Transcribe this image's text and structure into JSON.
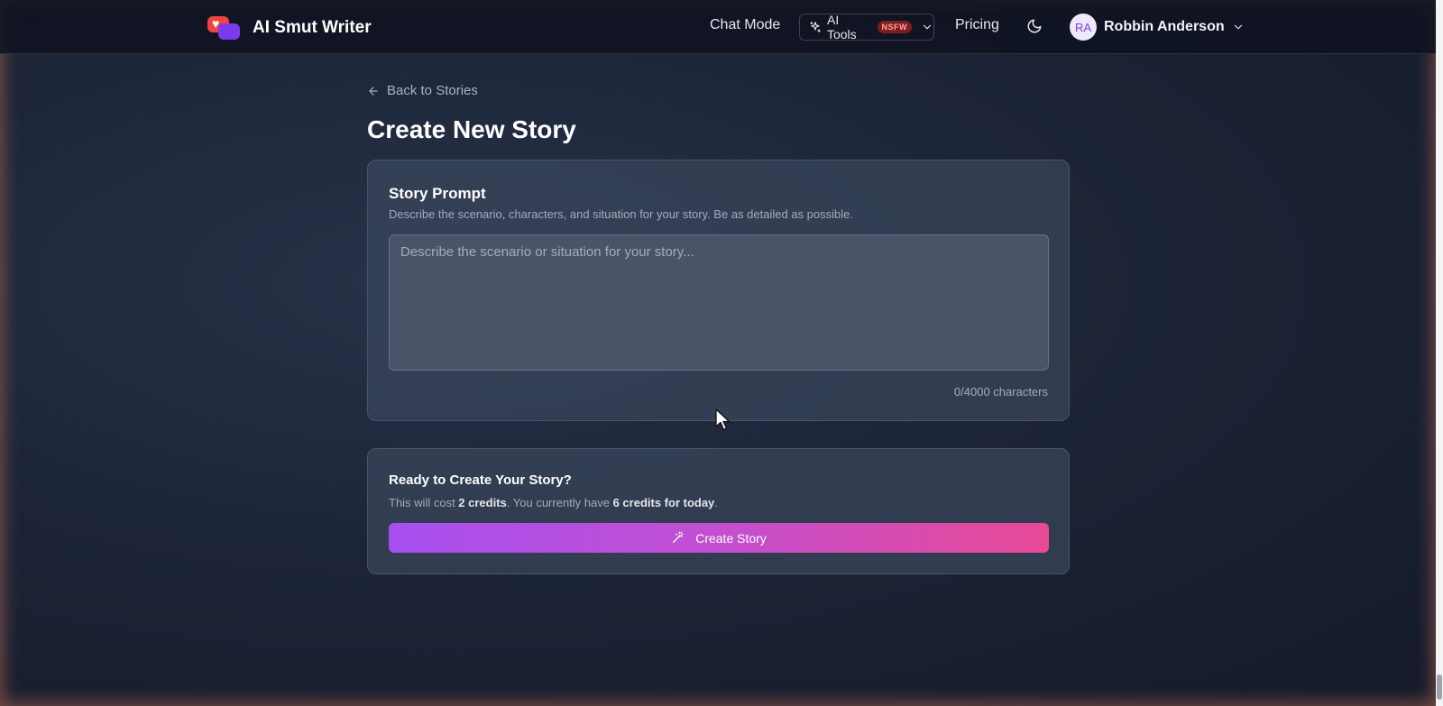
{
  "header": {
    "brand_name": "AI Smut Writer",
    "nav_chat_mode": "Chat Mode",
    "ai_tools_label": "AI Tools",
    "ai_tools_badge": "NSFW",
    "nav_pricing": "Pricing",
    "user_initials": "RA",
    "user_name": "Robbin Anderson"
  },
  "main": {
    "back_link": "Back to Stories",
    "page_title": "Create New Story"
  },
  "prompt_card": {
    "title": "Story Prompt",
    "description": "Describe the scenario, characters, and situation for your story. Be as detailed as possible.",
    "input_value": "",
    "input_placeholder": "Describe the scenario or situation for your story...",
    "char_count": "0/4000 characters"
  },
  "create_card": {
    "title": "Ready to Create Your Story?",
    "cost_prefix": "This will cost ",
    "cost_amount": "2 credits",
    "cost_middle": ". You currently have ",
    "credits_today": "6 credits for today",
    "cost_suffix": ".",
    "button_label": "Create Story"
  },
  "icons": {
    "logo": "heart-chat-logo-icon",
    "ai_tools": "sparkles-icon",
    "dropdown": "chevron-down-icon",
    "theme": "moon-icon",
    "back": "arrow-left-icon",
    "create": "magic-wand-icon"
  },
  "colors": {
    "background": "#1c2437",
    "card": "#3a455b",
    "button_gradient_start": "#a64ff0",
    "button_gradient_end": "#e84a96",
    "badge_bg": "#7f1d1d",
    "avatar_bg": "#ede9fe",
    "avatar_text": "#7c3aed"
  }
}
